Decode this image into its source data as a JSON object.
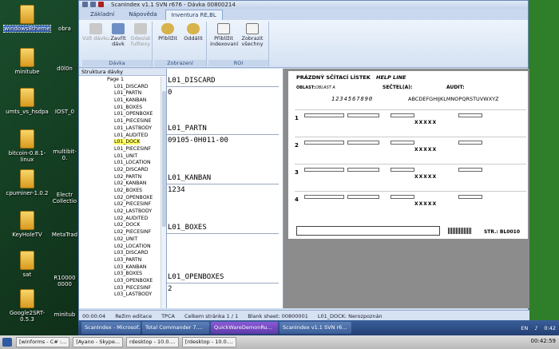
{
  "desktop_icons": [
    {
      "label": "windows8theme",
      "selected": true
    },
    {
      "label": "minitube"
    },
    {
      "label": "umts_vs_hsdpa"
    },
    {
      "label": "bitcoin-0.8.1-linux"
    },
    {
      "label": "cpuminer-1.0.2"
    },
    {
      "label": "KeyHoleTV"
    },
    {
      "label": "sat"
    },
    {
      "label": "Google2SRT-0.5.3"
    }
  ],
  "desktop_partial_labels": [
    "obra",
    "d0l0n",
    "IOST_0",
    "multibit-0.",
    "Electr Collectio",
    "MetaTrad",
    "R10000 0000",
    "minitub"
  ],
  "window": {
    "title": "ScanIndex v1.1 SVN r676 - Dávka 00800214",
    "tabs": [
      "Základní",
      "Nápověda",
      "Inventura RE,BL"
    ],
    "active_tab": 2,
    "ribbon": {
      "groups": [
        {
          "label": "Dávka",
          "buttons": [
            "Vzít dávku",
            "Zavřít dávk",
            "Odeslat fulltexy"
          ]
        },
        {
          "label": "Zobrazení",
          "buttons": [
            "Přiblížit",
            "Oddálit"
          ]
        },
        {
          "label": "ROI",
          "buttons": [
            "Přiblížit indexovaní",
            "Zobrazit všechny"
          ]
        }
      ]
    },
    "tree": {
      "header": "Struktura dávky",
      "root": "Page 1",
      "items": [
        "L01_DISCARD",
        "L01_PARTN",
        "L01_KANBAN",
        "L01_BOXES",
        "L01_OPENBOXE",
        "L01_PIECESINE",
        "L01_LASTBODY",
        "L01_AUDITED",
        "L01_DOCK",
        "L01_PIECESINF",
        "L01_UNIT",
        "L01_LOCATION",
        "L02_DISCARD",
        "L02_PARTN",
        "L02_KANBAN",
        "L02_BOXES",
        "L02_OPENBOXE",
        "L02_PIECESINF",
        "L02_LASTBODY",
        "L02_AUDITED",
        "L02_DOCK",
        "L02_PIECESINF",
        "L02_UNIT",
        "L02_LOCATION",
        "L03_DISCARD",
        "L03_PARTN",
        "L03_KANBAN",
        "L03_BOXES",
        "L03_OPENBOXE",
        "L03_PIECESINF",
        "L03_LASTBODY"
      ],
      "highlighted_index": 8
    },
    "fields": [
      {
        "label": "L01_DISCARD",
        "value": "0"
      },
      {
        "label": "L01_PARTN",
        "value": "09105-0H011-00"
      },
      {
        "label": "L01_KANBAN",
        "value": "1234"
      },
      {
        "label": "L01_BOXES",
        "value": ""
      },
      {
        "label": "L01_OPENBOXES",
        "value": "2"
      }
    ],
    "document": {
      "title": "PRÁZDNÝ SČÍTACÍ LÍSTEK",
      "helpline": "HELP LINE",
      "oblast_label": "OBLAST:",
      "oblast_value": "OBLAST A",
      "secteni_label": "SEČTEL(A):",
      "audit_label": "AUDIT:",
      "digits": "1234567890",
      "alphabet": "ABCDEFGHIJKLMNOPQRSTUVWXYZ",
      "row_numbers": [
        "1",
        "2",
        "3",
        "4"
      ],
      "xxx": "XXXXX",
      "str_label": "STR.: BL0010"
    },
    "status": {
      "time": "00:00:04",
      "mode": "Režim editace",
      "tpca": "TPCA",
      "pages": "Celkem stránka 1 / 1",
      "blank": "Blank sheet: 00800001",
      "field": "L01_DOCK: Nerozpoznán"
    }
  },
  "taskbar": {
    "items": [
      "ScanIndex - Microsof...",
      "Total Commander 7....",
      "QuickWareDemonRu...",
      "ScanIndex v1.1 SVN r6..."
    ],
    "active": 2,
    "lang": "EN",
    "clock": "0:42"
  },
  "bottom_bar": {
    "items": [
      "[winforms - C# :...",
      "[Ayano - Skype...",
      "rdesktop - 10.0....",
      "[rdesktop - 10.0...."
    ],
    "clock": "00:42:59"
  }
}
